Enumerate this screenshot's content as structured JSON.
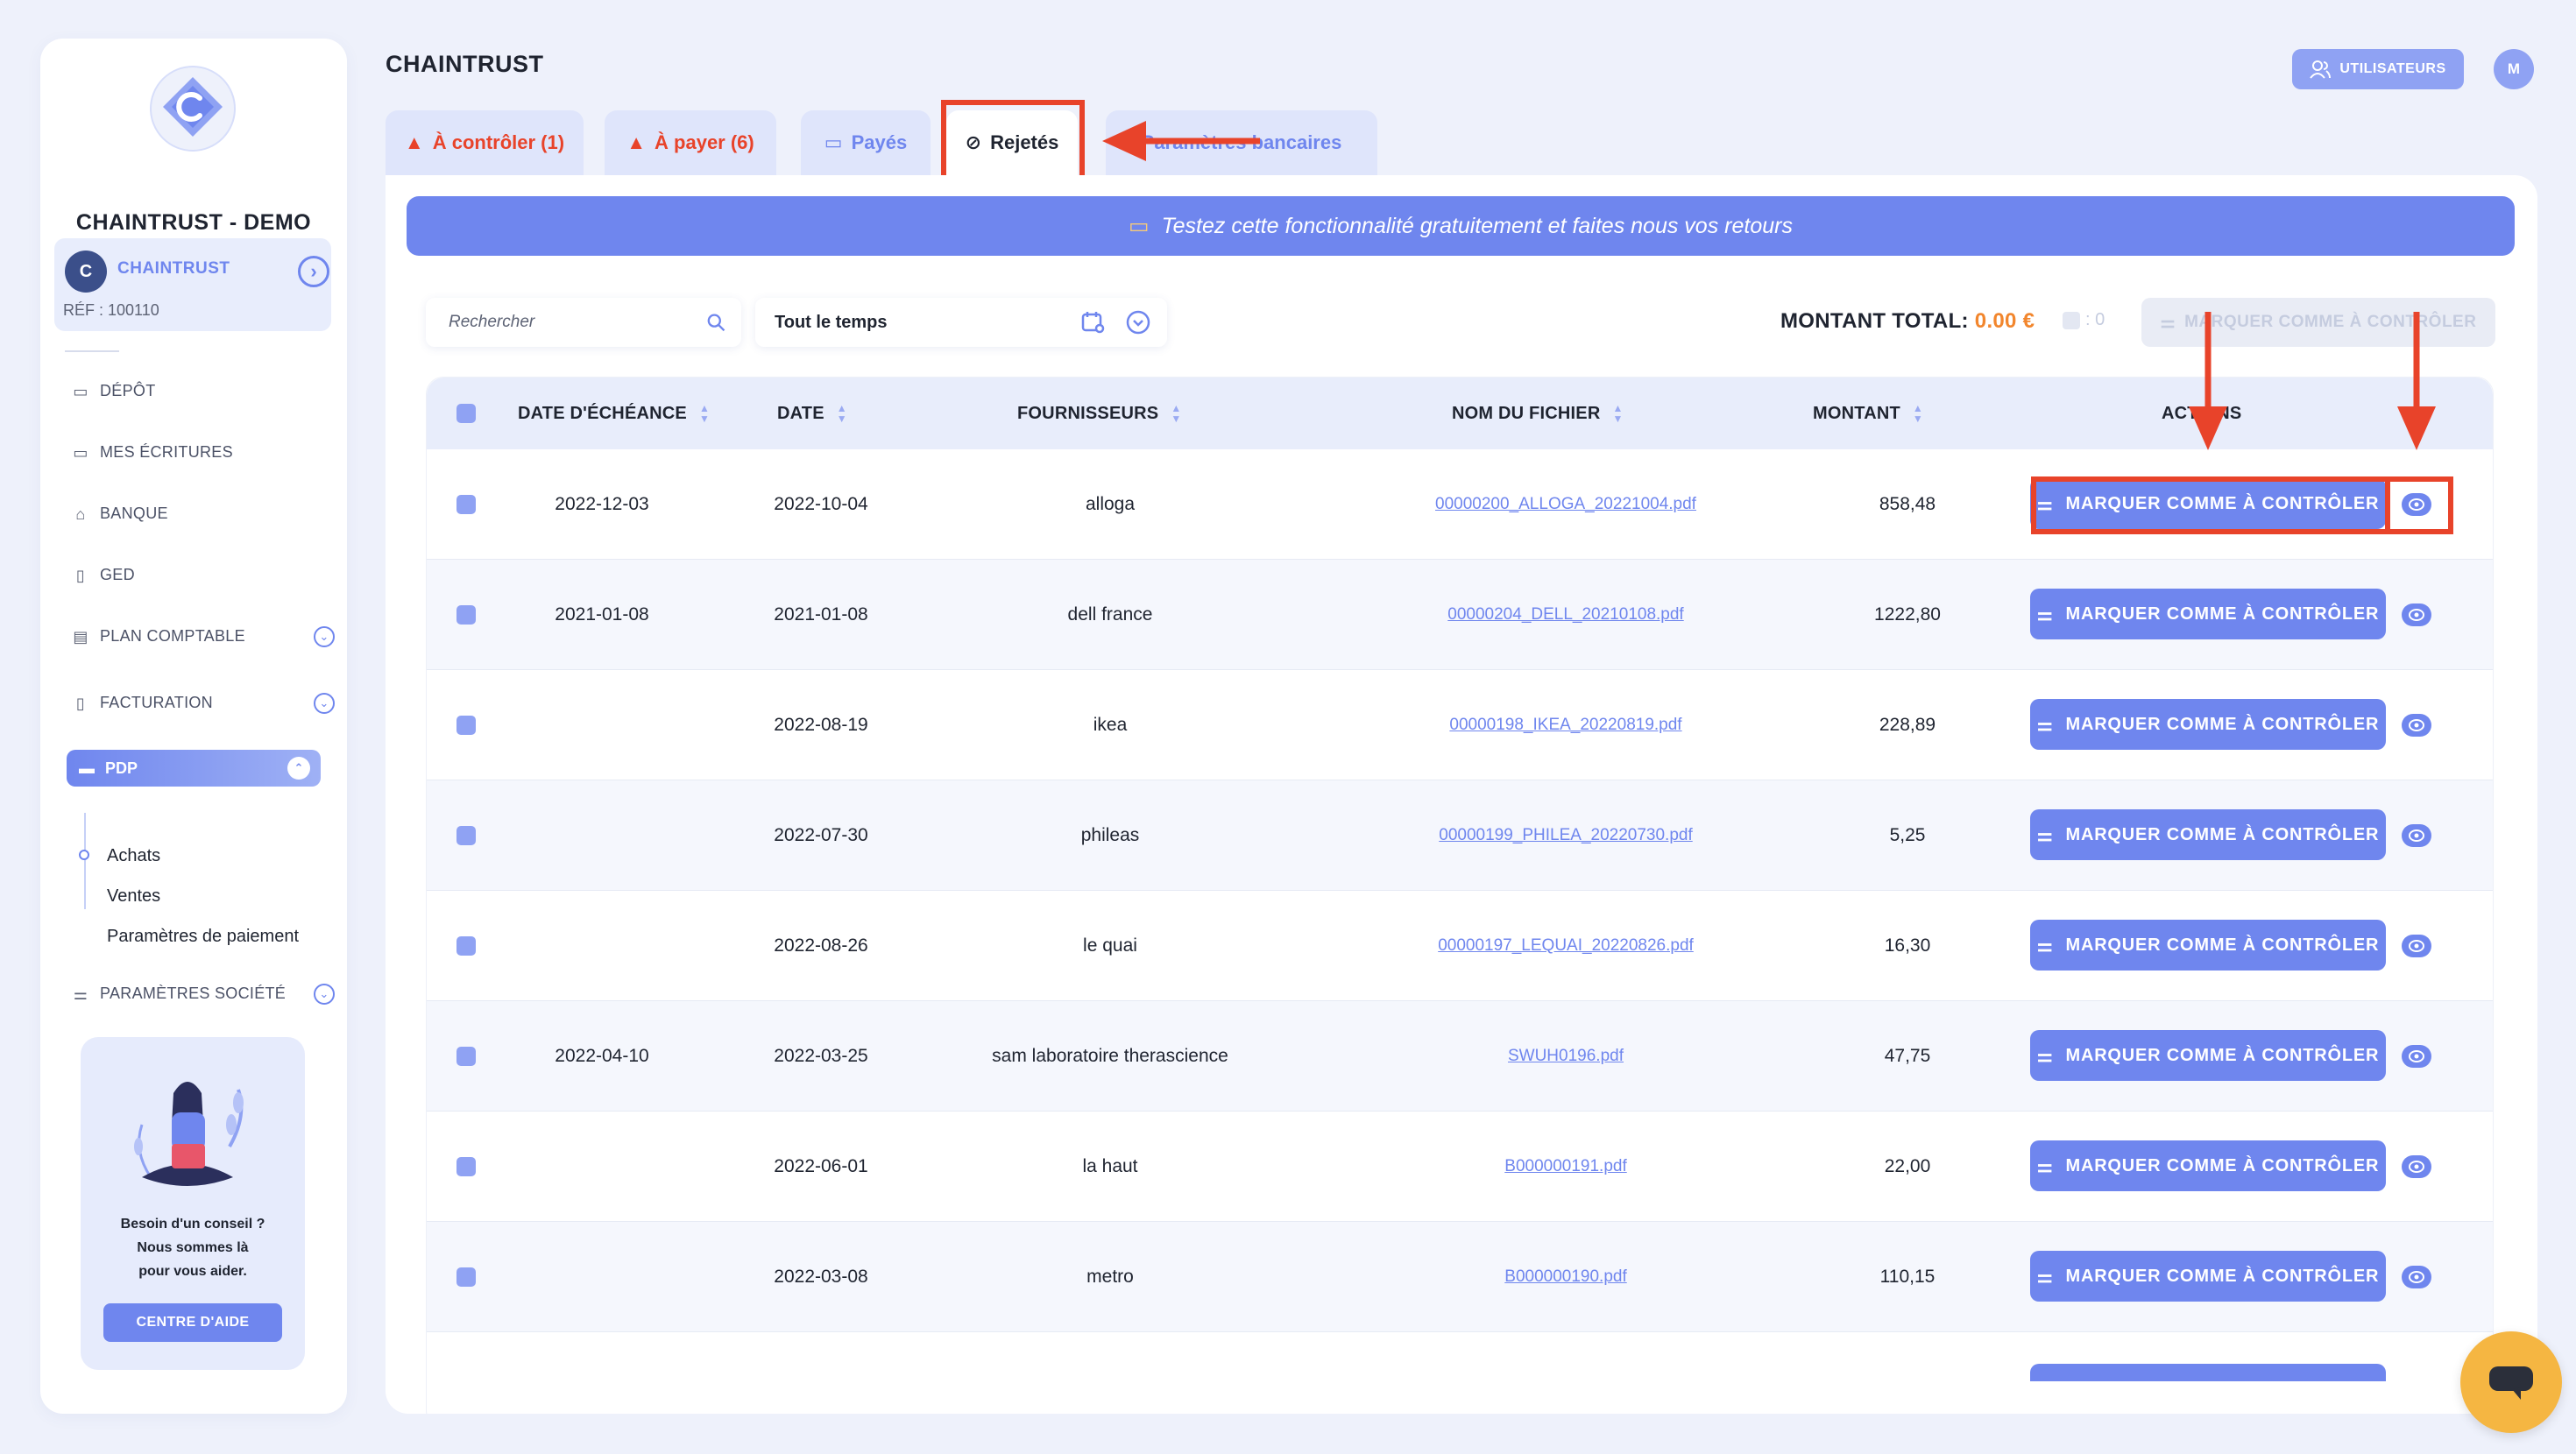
{
  "sidebar": {
    "org_name": "CHAINTRUST - DEMO",
    "company": {
      "logo_letter": "C",
      "name": "CHAINTRUST",
      "ref": "RÉF : 100110"
    },
    "items": [
      {
        "label": "DÉPÔT",
        "icon": "folder-icon"
      },
      {
        "label": "MES ÉCRITURES",
        "icon": "folder-icon"
      },
      {
        "label": "BANQUE",
        "icon": "bank-icon"
      },
      {
        "label": "GED",
        "icon": "document-icon"
      },
      {
        "label": "PLAN COMPTABLE",
        "icon": "ledger-icon"
      },
      {
        "label": "FACTURATION",
        "icon": "invoice-icon"
      },
      {
        "label": "PDP",
        "icon": "card-icon"
      },
      {
        "label": "PARAMÈTRES SOCIÉTÉ",
        "icon": "sliders-icon"
      }
    ],
    "pdp_sub": [
      "Achats",
      "Ventes",
      "Paramètres de paiement"
    ],
    "help": {
      "line1": "Besoin d'un conseil ?",
      "line2": "Nous sommes là",
      "line3": "pour vous aider.",
      "button": "CENTRE D'AIDE"
    }
  },
  "header": {
    "title": "CHAINTRUST",
    "users_button": "UTILISATEURS",
    "avatar": "M"
  },
  "tabs": [
    {
      "label": "À contrôler (1)",
      "icon": "warning-icon"
    },
    {
      "label": "À payer (6)",
      "icon": "warning-icon"
    },
    {
      "label": "Payés",
      "icon": "payment-icon"
    },
    {
      "label": "Rejetés",
      "icon": "ban-icon"
    },
    {
      "label": "Paramètres bancaires",
      "icon": ""
    }
  ],
  "banner": "Testez cette fonctionnalité gratuitement et faites nous vos retours",
  "toolbar": {
    "search_placeholder": "Rechercher",
    "date_filter": "Tout le temps",
    "total_label": "MONTANT TOTAL:",
    "total_value": "0.00 €",
    "selected_count": ": 0",
    "bulk_button": "MARQUER COMME À CONTRÔLER"
  },
  "table": {
    "headers": [
      "DATE D'ÉCHÉANCE",
      "DATE",
      "FOURNISSEURS",
      "NOM DU FICHIER",
      "MONTANT",
      "ACTIONS"
    ],
    "action_label": "MARQUER COMME À CONTRÔLER",
    "rows": [
      {
        "due": "2022-12-03",
        "date": "2022-10-04",
        "supplier": "alloga",
        "file": "00000200_ALLOGA_20221004.pdf",
        "amount": "858,48"
      },
      {
        "due": "2021-01-08",
        "date": "2021-01-08",
        "supplier": "dell france",
        "file": "00000204_DELL_20210108.pdf",
        "amount": "1222,80"
      },
      {
        "due": "",
        "date": "2022-08-19",
        "supplier": "ikea",
        "file": "00000198_IKEA_20220819.pdf",
        "amount": "228,89"
      },
      {
        "due": "",
        "date": "2022-07-30",
        "supplier": "phileas",
        "file": "00000199_PHILEA_20220730.pdf",
        "amount": "5,25"
      },
      {
        "due": "",
        "date": "2022-08-26",
        "supplier": "le quai",
        "file": "00000197_LEQUAI_20220826.pdf",
        "amount": "16,30"
      },
      {
        "due": "2022-04-10",
        "date": "2022-03-25",
        "supplier": "sam laboratoire therascience",
        "file": "SWUH0196.pdf",
        "amount": "47,75"
      },
      {
        "due": "",
        "date": "2022-06-01",
        "supplier": "la haut",
        "file": "B000000191.pdf",
        "amount": "22,00"
      },
      {
        "due": "",
        "date": "2022-03-08",
        "supplier": "metro",
        "file": "B000000190.pdf",
        "amount": "110,15"
      }
    ]
  },
  "colors": {
    "accent": "#6f86ee",
    "warning": "#e8432a",
    "total": "#f2862d",
    "chat": "#f5b642"
  }
}
